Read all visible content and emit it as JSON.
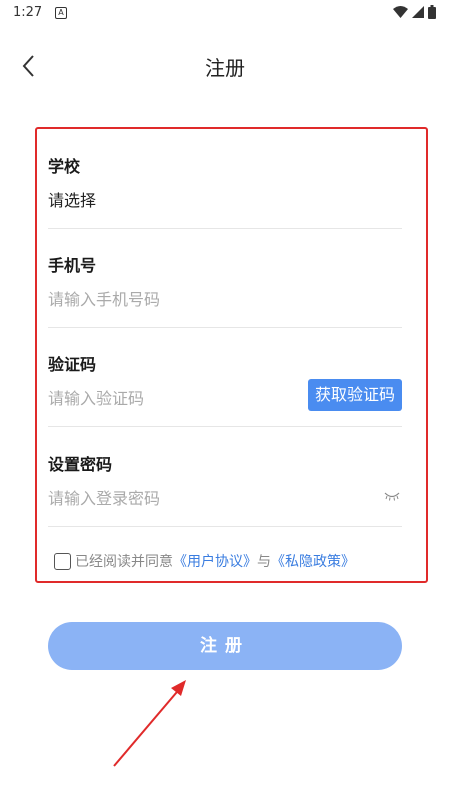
{
  "status_bar": {
    "time": "1:27",
    "notification": "A"
  },
  "header": {
    "title": "注册"
  },
  "form": {
    "school": {
      "label": "学校",
      "value": "请选择"
    },
    "phone": {
      "label": "手机号",
      "placeholder": "请输入手机号码"
    },
    "code": {
      "label": "验证码",
      "placeholder": "请输入验证码",
      "button_label": "获取验证码"
    },
    "password": {
      "label": "设置密码",
      "placeholder": "请输入登录密码"
    }
  },
  "agreement": {
    "prefix": "已经阅读并同意",
    "user_agreement": "《用户协议》",
    "and": "与",
    "privacy_policy": "《私隐政策》"
  },
  "register_button": {
    "label": "注册"
  },
  "colors": {
    "accent": "#4a8cf0",
    "button": "#8bb3f5",
    "highlight": "#e02a2a",
    "link": "#3a7de0"
  }
}
